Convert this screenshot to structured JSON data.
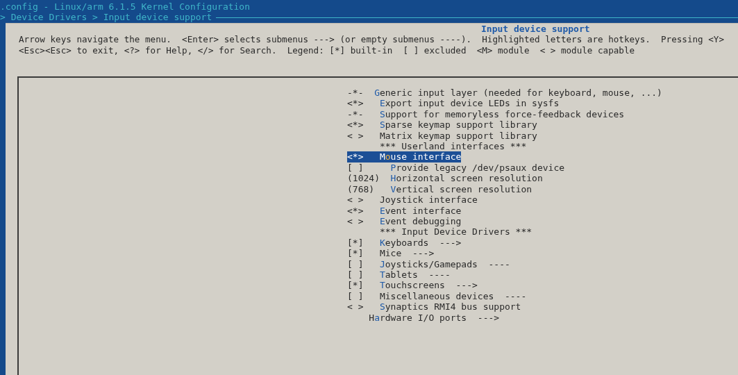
{
  "window": {
    "title": ".config - Linux/arm 6.1.5 Kernel Configuration"
  },
  "breadcrumb": "> Device Drivers > Input device support",
  "dialog": {
    "title": "Input device support",
    "help": [
      "Arrow keys navigate the menu.  <Enter> selects submenus ---> (or empty submenus ----).  Highlighted letters are hotkeys.  Pressing <Y>",
      "<Esc><Esc> to exit, <?> for Help, </> for Search.  Legend: [*] built-in  [ ] excluded  <M> module  < > module capable"
    ]
  },
  "menu": {
    "items": [
      {
        "kind": "option",
        "prefix": "-*-",
        "label": "Generic input layer (needed for keyboard, mouse, ...)",
        "highlight_first": true,
        "highlight_second": false,
        "selected": false,
        "children": [
          {
            "kind": "option",
            "prefix": "<*>",
            "label": "Export input device LEDs in sysfs",
            "highlight_first": true,
            "highlight_second": false,
            "selected": false
          },
          {
            "kind": "option",
            "prefix": "-*-",
            "label": "Support for memoryless force-feedback devices",
            "highlight_first": true,
            "highlight_second": false,
            "selected": false
          },
          {
            "kind": "option",
            "prefix": "<*>",
            "label": "Sparse keymap support library",
            "highlight_first": true,
            "highlight_second": false,
            "selected": false
          },
          {
            "kind": "option",
            "prefix": "< >",
            "label": "Matrix keymap support library",
            "highlight_first": false,
            "highlight_second": false,
            "selected": false
          },
          {
            "kind": "comment",
            "label": "*** Userland interfaces ***",
            "selected": false
          },
          {
            "kind": "option",
            "prefix": "<*>",
            "label": "Mouse interface",
            "highlight_first": false,
            "highlight_second": true,
            "selected": true,
            "children": [
              {
                "kind": "option",
                "prefix": "[ ]",
                "label": "Provide legacy /dev/psaux device",
                "highlight_first": true,
                "highlight_second": false,
                "selected": false
              },
              {
                "kind": "option",
                "prefix": "(1024)",
                "label": "Horizontal screen resolution",
                "highlight_first": true,
                "highlight_second": false,
                "selected": false
              },
              {
                "kind": "option",
                "prefix": "(768)",
                "label": "Vertical screen resolution",
                "highlight_first": true,
                "highlight_second": false,
                "selected": false
              }
            ]
          },
          {
            "kind": "option",
            "prefix": "< >",
            "label": "Joystick interface",
            "highlight_first": false,
            "highlight_second": false,
            "selected": false
          },
          {
            "kind": "option",
            "prefix": "<*>",
            "label": "Event interface",
            "highlight_first": true,
            "highlight_second": false,
            "selected": false
          },
          {
            "kind": "option",
            "prefix": "< >",
            "label": "Event debugging",
            "highlight_first": true,
            "highlight_second": false,
            "selected": false
          },
          {
            "kind": "comment",
            "label": "*** Input Device Drivers ***",
            "selected": false
          },
          {
            "kind": "option",
            "prefix": "[*]",
            "label": "Keyboards  --->",
            "highlight_first": true,
            "highlight_second": false,
            "selected": false
          },
          {
            "kind": "option",
            "prefix": "[*]",
            "label": "Mice  --->",
            "highlight_first": false,
            "highlight_second": false,
            "selected": false
          },
          {
            "kind": "option",
            "prefix": "[ ]",
            "label": "Joysticks/Gamepads  ----",
            "highlight_first": true,
            "highlight_second": false,
            "selected": false
          },
          {
            "kind": "option",
            "prefix": "[ ]",
            "label": "Tablets  ----",
            "highlight_first": true,
            "highlight_second": false,
            "selected": false
          },
          {
            "kind": "option",
            "prefix": "[*]",
            "label": "Touchscreens  --->",
            "highlight_first": true,
            "highlight_second": false,
            "selected": false
          },
          {
            "kind": "option",
            "prefix": "[ ]",
            "label": "Miscellaneous devices  ----",
            "highlight_first": false,
            "highlight_second": false,
            "selected": false
          },
          {
            "kind": "option",
            "prefix": "< >",
            "label": "Synaptics RMI4 bus support",
            "highlight_first": true,
            "highlight_second": false,
            "selected": false
          }
        ]
      },
      {
        "kind": "option",
        "label": "Hardware I/O ports  --->",
        "highlight_first": false,
        "highlight_second": true,
        "selected": false
      }
    ]
  }
}
